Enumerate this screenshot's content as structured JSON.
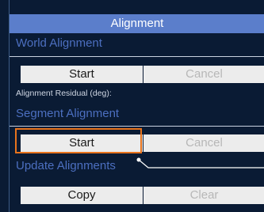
{
  "panel": {
    "title": "Alignment",
    "world_alignment": {
      "title": "World Alignment",
      "start_label": "Start",
      "cancel_label": "Cancel"
    },
    "residual_label": "Alignment Residual (deg):",
    "segment_alignment": {
      "title": "Segment Alignment",
      "start_label": "Start",
      "cancel_label": "Cancel"
    },
    "update_alignments": {
      "title": "Update Alignments",
      "copy_label": "Copy",
      "clear_label": "Clear"
    }
  },
  "colors": {
    "background": "#0a1b34",
    "title_bar": "#5b7ecb",
    "section_title": "#4c6fc0",
    "highlight": "#e8731c"
  }
}
